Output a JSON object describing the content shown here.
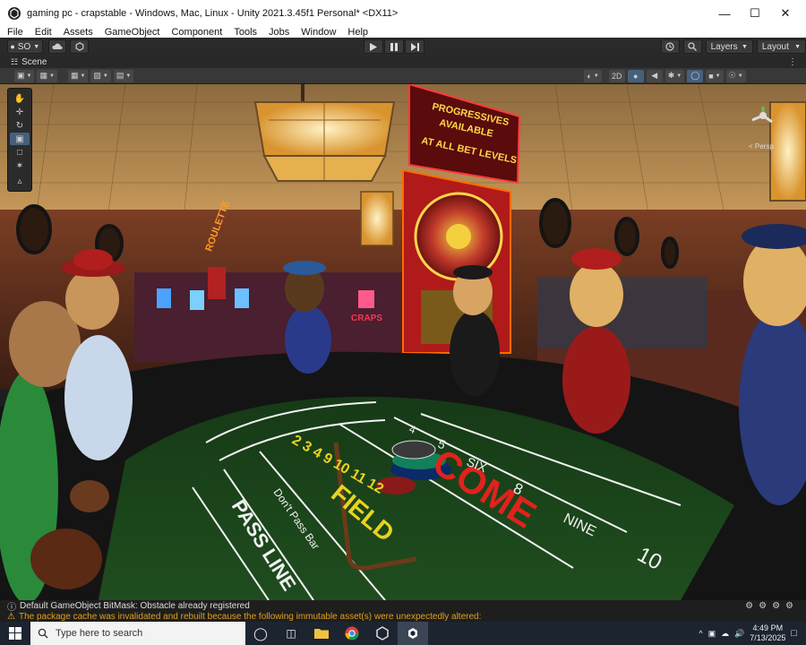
{
  "window": {
    "title": "gaming pc - crapstable - Windows, Mac, Linux - Unity 2021.3.45f1 Personal* <DX11>",
    "minimize": "—",
    "maximize": "☐",
    "close": "✕"
  },
  "menu": [
    "File",
    "Edit",
    "Assets",
    "GameObject",
    "Component",
    "Tools",
    "Jobs",
    "Window",
    "Help"
  ],
  "toolbar": {
    "account": "SO",
    "layers": "Layers",
    "layout": "Layout"
  },
  "scene": {
    "tab_label": "Scene",
    "mode_2d": "2D"
  },
  "viewport_text": {
    "progressive_sign": [
      "PROGRESSIVES",
      "AVAILABLE",
      "AT ALL BET LEVELS"
    ],
    "roulette_sign": "ROULETTE",
    "craps_sign": "CRAPS",
    "pass_line": "PASS LINE",
    "dont_pass_bar": "Don't Pass Bar",
    "field": "FIELD",
    "come": "COME",
    "field_numbers": "2 3 4 9 10 11 12",
    "numbers": [
      "4",
      "5",
      "SIX",
      "8",
      "NINE",
      "10"
    ],
    "persp_label": "< Persp"
  },
  "console": {
    "line1": "Default GameObject BitMask: Obstacle already registered",
    "line2": "The package cache was invalidated and rebuilt because the following immutable asset(s) were unexpectedly altered:"
  },
  "taskbar": {
    "search_placeholder": "Type here to search",
    "time": "4:49 PM",
    "date": "7/13/2025"
  },
  "colors": {
    "felt": "#1d4a1d",
    "felt_line": "#f2f2f2",
    "come_red": "#e0231c",
    "field_yellow": "#e8d321",
    "toolbar_dark": "#383838"
  }
}
